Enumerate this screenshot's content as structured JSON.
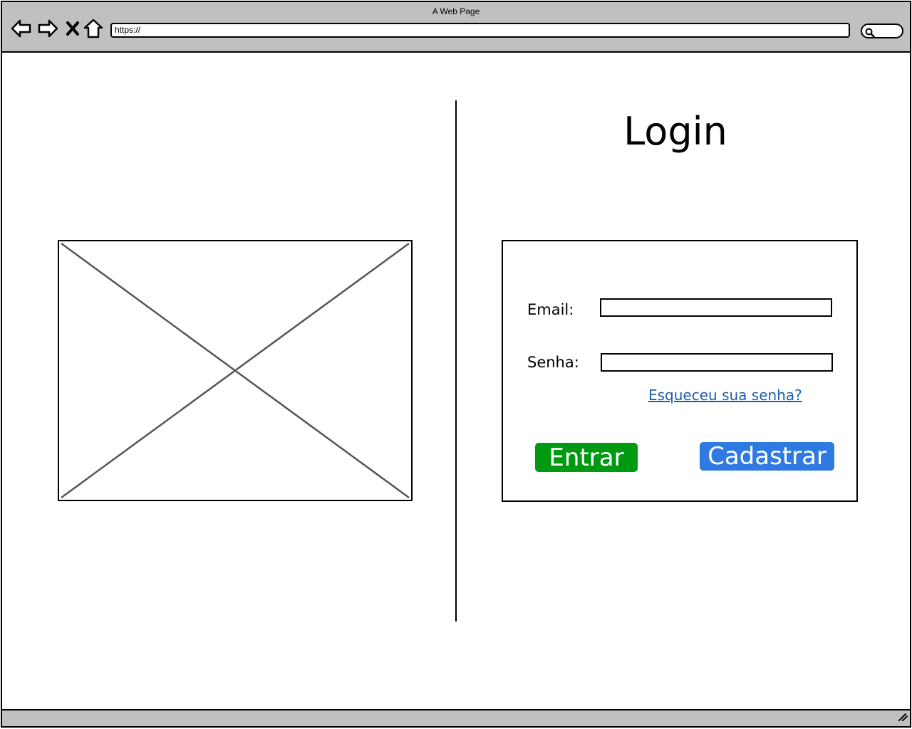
{
  "browser": {
    "window_title": "A Web Page",
    "url": "https://",
    "icons": {
      "back": "back-arrow-icon",
      "forward": "forward-arrow-icon",
      "stop": "close-icon",
      "home": "home-icon",
      "search": "search-icon",
      "resize": "resize-grip-icon"
    }
  },
  "left_panel": {
    "image": "image-placeholder"
  },
  "login": {
    "title": "Login",
    "email_label": "Email:",
    "email_value": "",
    "password_label": "Senha:",
    "password_value": "",
    "forgot_link": "Esqueceu sua senha?",
    "enter_button": "Entrar",
    "register_button": "Cadastrar"
  },
  "colors": {
    "chrome_gray": "#c0c0c0",
    "enter_green": "#009a12",
    "register_blue": "#2e7ae0",
    "link_blue": "#1f5fa8"
  }
}
